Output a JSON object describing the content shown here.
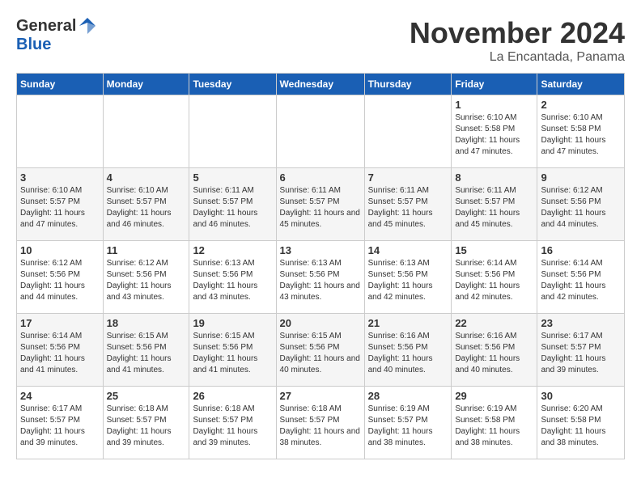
{
  "header": {
    "logo_general": "General",
    "logo_blue": "Blue",
    "month_title": "November 2024",
    "location": "La Encantada, Panama"
  },
  "calendar": {
    "days_of_week": [
      "Sunday",
      "Monday",
      "Tuesday",
      "Wednesday",
      "Thursday",
      "Friday",
      "Saturday"
    ],
    "weeks": [
      [
        {
          "day": "",
          "info": ""
        },
        {
          "day": "",
          "info": ""
        },
        {
          "day": "",
          "info": ""
        },
        {
          "day": "",
          "info": ""
        },
        {
          "day": "",
          "info": ""
        },
        {
          "day": "1",
          "info": "Sunrise: 6:10 AM\nSunset: 5:58 PM\nDaylight: 11 hours and 47 minutes."
        },
        {
          "day": "2",
          "info": "Sunrise: 6:10 AM\nSunset: 5:58 PM\nDaylight: 11 hours and 47 minutes."
        }
      ],
      [
        {
          "day": "3",
          "info": "Sunrise: 6:10 AM\nSunset: 5:57 PM\nDaylight: 11 hours and 47 minutes."
        },
        {
          "day": "4",
          "info": "Sunrise: 6:10 AM\nSunset: 5:57 PM\nDaylight: 11 hours and 46 minutes."
        },
        {
          "day": "5",
          "info": "Sunrise: 6:11 AM\nSunset: 5:57 PM\nDaylight: 11 hours and 46 minutes."
        },
        {
          "day": "6",
          "info": "Sunrise: 6:11 AM\nSunset: 5:57 PM\nDaylight: 11 hours and 45 minutes."
        },
        {
          "day": "7",
          "info": "Sunrise: 6:11 AM\nSunset: 5:57 PM\nDaylight: 11 hours and 45 minutes."
        },
        {
          "day": "8",
          "info": "Sunrise: 6:11 AM\nSunset: 5:57 PM\nDaylight: 11 hours and 45 minutes."
        },
        {
          "day": "9",
          "info": "Sunrise: 6:12 AM\nSunset: 5:56 PM\nDaylight: 11 hours and 44 minutes."
        }
      ],
      [
        {
          "day": "10",
          "info": "Sunrise: 6:12 AM\nSunset: 5:56 PM\nDaylight: 11 hours and 44 minutes."
        },
        {
          "day": "11",
          "info": "Sunrise: 6:12 AM\nSunset: 5:56 PM\nDaylight: 11 hours and 43 minutes."
        },
        {
          "day": "12",
          "info": "Sunrise: 6:13 AM\nSunset: 5:56 PM\nDaylight: 11 hours and 43 minutes."
        },
        {
          "day": "13",
          "info": "Sunrise: 6:13 AM\nSunset: 5:56 PM\nDaylight: 11 hours and 43 minutes."
        },
        {
          "day": "14",
          "info": "Sunrise: 6:13 AM\nSunset: 5:56 PM\nDaylight: 11 hours and 42 minutes."
        },
        {
          "day": "15",
          "info": "Sunrise: 6:14 AM\nSunset: 5:56 PM\nDaylight: 11 hours and 42 minutes."
        },
        {
          "day": "16",
          "info": "Sunrise: 6:14 AM\nSunset: 5:56 PM\nDaylight: 11 hours and 42 minutes."
        }
      ],
      [
        {
          "day": "17",
          "info": "Sunrise: 6:14 AM\nSunset: 5:56 PM\nDaylight: 11 hours and 41 minutes."
        },
        {
          "day": "18",
          "info": "Sunrise: 6:15 AM\nSunset: 5:56 PM\nDaylight: 11 hours and 41 minutes."
        },
        {
          "day": "19",
          "info": "Sunrise: 6:15 AM\nSunset: 5:56 PM\nDaylight: 11 hours and 41 minutes."
        },
        {
          "day": "20",
          "info": "Sunrise: 6:15 AM\nSunset: 5:56 PM\nDaylight: 11 hours and 40 minutes."
        },
        {
          "day": "21",
          "info": "Sunrise: 6:16 AM\nSunset: 5:56 PM\nDaylight: 11 hours and 40 minutes."
        },
        {
          "day": "22",
          "info": "Sunrise: 6:16 AM\nSunset: 5:56 PM\nDaylight: 11 hours and 40 minutes."
        },
        {
          "day": "23",
          "info": "Sunrise: 6:17 AM\nSunset: 5:57 PM\nDaylight: 11 hours and 39 minutes."
        }
      ],
      [
        {
          "day": "24",
          "info": "Sunrise: 6:17 AM\nSunset: 5:57 PM\nDaylight: 11 hours and 39 minutes."
        },
        {
          "day": "25",
          "info": "Sunrise: 6:18 AM\nSunset: 5:57 PM\nDaylight: 11 hours and 39 minutes."
        },
        {
          "day": "26",
          "info": "Sunrise: 6:18 AM\nSunset: 5:57 PM\nDaylight: 11 hours and 39 minutes."
        },
        {
          "day": "27",
          "info": "Sunrise: 6:18 AM\nSunset: 5:57 PM\nDaylight: 11 hours and 38 minutes."
        },
        {
          "day": "28",
          "info": "Sunrise: 6:19 AM\nSunset: 5:57 PM\nDaylight: 11 hours and 38 minutes."
        },
        {
          "day": "29",
          "info": "Sunrise: 6:19 AM\nSunset: 5:58 PM\nDaylight: 11 hours and 38 minutes."
        },
        {
          "day": "30",
          "info": "Sunrise: 6:20 AM\nSunset: 5:58 PM\nDaylight: 11 hours and 38 minutes."
        }
      ]
    ]
  }
}
